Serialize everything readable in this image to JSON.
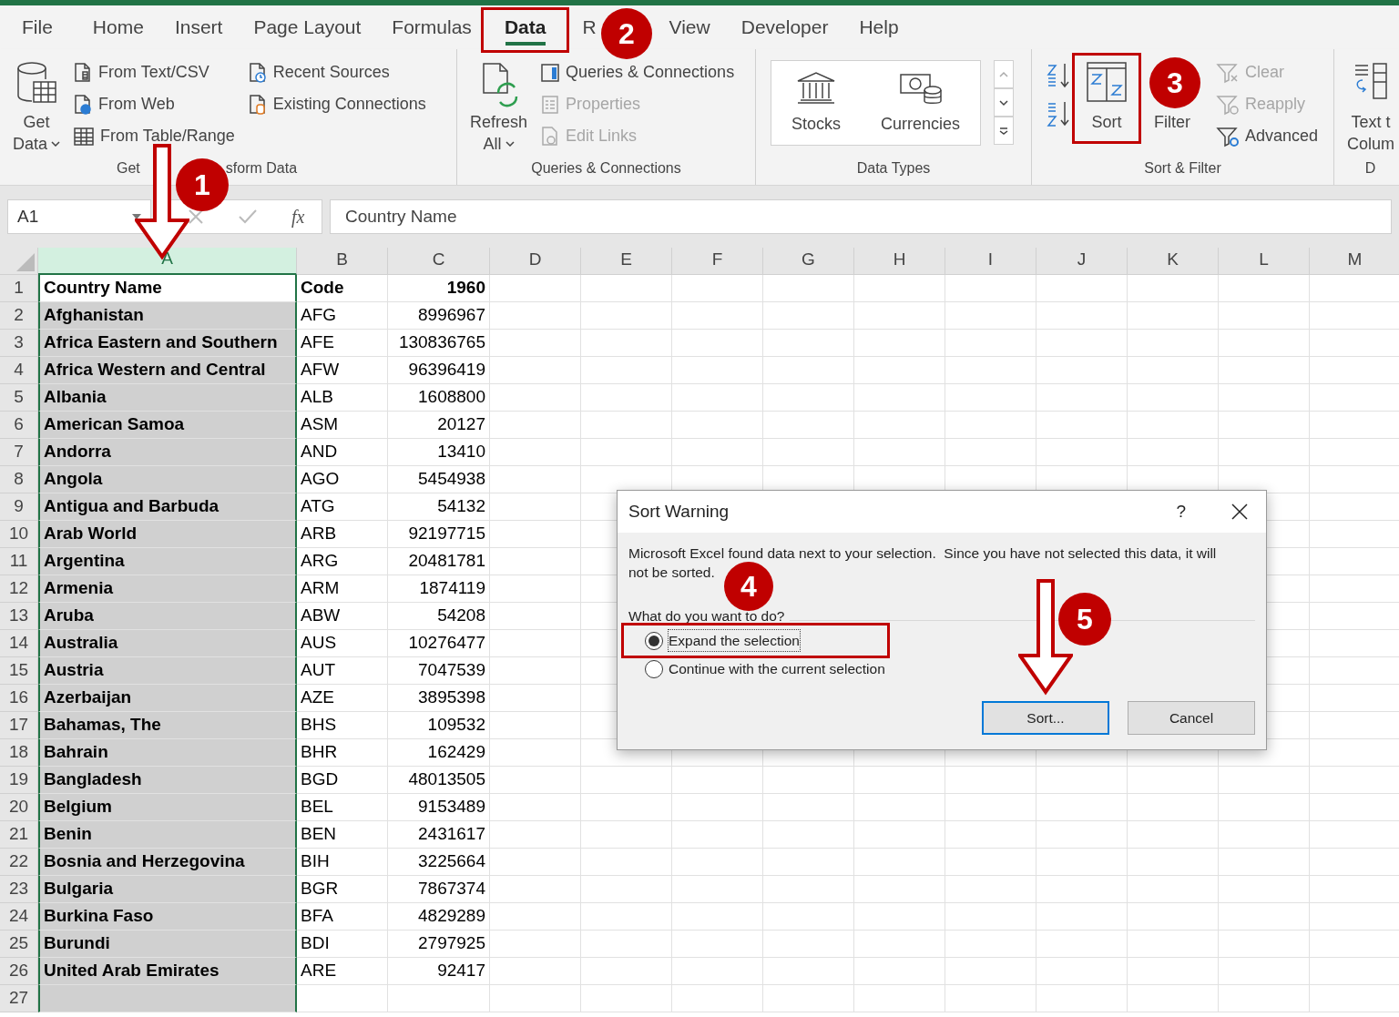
{
  "tabs": [
    {
      "label": "File",
      "selected": false
    },
    {
      "label": "Home",
      "selected": false
    },
    {
      "label": "Insert",
      "selected": false
    },
    {
      "label": "Page Layout",
      "selected": false
    },
    {
      "label": "Formulas",
      "selected": false
    },
    {
      "label": "Data",
      "selected": true,
      "highlighted": true
    },
    {
      "label": "R",
      "selected": false
    },
    {
      "label": "View",
      "selected": false
    },
    {
      "label": "Developer",
      "selected": false
    },
    {
      "label": "Help",
      "selected": false
    }
  ],
  "ribbon": {
    "groups": [
      {
        "title": "Get",
        "title_tail": "sform Data",
        "columns": [
          [
            {
              "kind": "large",
              "lines": [
                "Get",
                "Data"
              ],
              "dropdown": true,
              "disabled": false
            }
          ],
          [
            {
              "kind": "small",
              "label": "From Text/CSV",
              "disabled": false
            },
            {
              "kind": "small",
              "label": "From Web",
              "disabled": false
            },
            {
              "kind": "small",
              "label": "From Table/Range",
              "disabled": false
            }
          ],
          [
            {
              "kind": "small",
              "label": "Recent Sources",
              "disabled": false
            },
            {
              "kind": "small",
              "label": "Existing Connections",
              "disabled": false
            }
          ]
        ]
      },
      {
        "title": "Queries & Connections",
        "columns": [
          [
            {
              "kind": "large",
              "lines": [
                "Refresh",
                "All"
              ],
              "dropdown": true,
              "disabled": false
            }
          ],
          [
            {
              "kind": "small",
              "label": "Queries & Connections",
              "disabled": false
            },
            {
              "kind": "small",
              "label": "Properties",
              "disabled": true
            },
            {
              "kind": "small",
              "label": "Edit Links",
              "disabled": true
            }
          ]
        ]
      },
      {
        "title": "Data Types",
        "gallery": [
          {
            "label": "Stocks"
          },
          {
            "label": "Currencies"
          }
        ]
      },
      {
        "title": "Sort & Filter",
        "columns": [
          [
            {
              "kind": "icon",
              "disabled": false
            },
            {
              "kind": "icon",
              "disabled": false
            }
          ],
          [
            {
              "kind": "large",
              "lines": [
                "Sort"
              ],
              "dropdown": false,
              "disabled": false,
              "highlighted": true
            }
          ],
          [
            {
              "kind": "large",
              "lines": [
                "Filter"
              ],
              "dropdown": false,
              "disabled": false
            }
          ],
          [
            {
              "kind": "small",
              "label": "Clear",
              "disabled": true
            },
            {
              "kind": "small",
              "label": "Reapply",
              "disabled": true
            },
            {
              "kind": "small",
              "label": "Advanced",
              "disabled": false
            }
          ]
        ]
      },
      {
        "title": "D",
        "columns": [
          [
            {
              "kind": "large",
              "lines": [
                "Text t",
                "Colum"
              ],
              "dropdown": false,
              "disabled": false
            }
          ]
        ]
      }
    ]
  },
  "formula_bar": {
    "name_box": "A1",
    "function_label": "fx",
    "value": "Country Name"
  },
  "sheet": {
    "columns": [
      {
        "label": "A",
        "selected": true
      },
      {
        "label": "B",
        "selected": false
      },
      {
        "label": "C",
        "selected": false
      },
      {
        "label": "D",
        "selected": false
      },
      {
        "label": "E",
        "selected": false
      },
      {
        "label": "F",
        "selected": false
      },
      {
        "label": "G",
        "selected": false
      },
      {
        "label": "H",
        "selected": false
      },
      {
        "label": "I",
        "selected": false
      },
      {
        "label": "J",
        "selected": false
      },
      {
        "label": "K",
        "selected": false
      },
      {
        "label": "L",
        "selected": false
      },
      {
        "label": "M",
        "selected": false
      }
    ],
    "rows": [
      {
        "number": "1",
        "cells": [
          "Country Name",
          "Code",
          "1960"
        ]
      },
      {
        "number": "2",
        "cells": [
          "Afghanistan",
          "AFG",
          "8996967"
        ]
      },
      {
        "number": "3",
        "cells": [
          "Africa Eastern and Southern",
          "AFE",
          "130836765"
        ]
      },
      {
        "number": "4",
        "cells": [
          "Africa Western and Central",
          "AFW",
          "96396419"
        ]
      },
      {
        "number": "5",
        "cells": [
          "Albania",
          "ALB",
          "1608800"
        ]
      },
      {
        "number": "6",
        "cells": [
          "American Samoa",
          "ASM",
          "20127"
        ]
      },
      {
        "number": "7",
        "cells": [
          "Andorra",
          "AND",
          "13410"
        ]
      },
      {
        "number": "8",
        "cells": [
          "Angola",
          "AGO",
          "5454938"
        ]
      },
      {
        "number": "9",
        "cells": [
          "Antigua and Barbuda",
          "ATG",
          "54132"
        ]
      },
      {
        "number": "10",
        "cells": [
          "Arab World",
          "ARB",
          "92197715"
        ]
      },
      {
        "number": "11",
        "cells": [
          "Argentina",
          "ARG",
          "20481781"
        ]
      },
      {
        "number": "12",
        "cells": [
          "Armenia",
          "ARM",
          "1874119"
        ]
      },
      {
        "number": "13",
        "cells": [
          "Aruba",
          "ABW",
          "54208"
        ]
      },
      {
        "number": "14",
        "cells": [
          "Australia",
          "AUS",
          "10276477"
        ]
      },
      {
        "number": "15",
        "cells": [
          "Austria",
          "AUT",
          "7047539"
        ]
      },
      {
        "number": "16",
        "cells": [
          "Azerbaijan",
          "AZE",
          "3895398"
        ]
      },
      {
        "number": "17",
        "cells": [
          "Bahamas, The",
          "BHS",
          "109532"
        ]
      },
      {
        "number": "18",
        "cells": [
          "Bahrain",
          "BHR",
          "162429"
        ]
      },
      {
        "number": "19",
        "cells": [
          "Bangladesh",
          "BGD",
          "48013505"
        ]
      },
      {
        "number": "20",
        "cells": [
          "Belgium",
          "BEL",
          "9153489"
        ]
      },
      {
        "number": "21",
        "cells": [
          "Benin",
          "BEN",
          "2431617"
        ]
      },
      {
        "number": "22",
        "cells": [
          "Bosnia and Herzegovina",
          "BIH",
          "3225664"
        ]
      },
      {
        "number": "23",
        "cells": [
          "Bulgaria",
          "BGR",
          "7867374"
        ]
      },
      {
        "number": "24",
        "cells": [
          "Burkina Faso",
          "BFA",
          "4829289"
        ]
      },
      {
        "number": "25",
        "cells": [
          "Burundi",
          "BDI",
          "2797925"
        ]
      },
      {
        "number": "26",
        "cells": [
          "United Arab Emirates",
          "ARE",
          "92417"
        ]
      },
      {
        "number": "27",
        "cells": []
      }
    ]
  },
  "dialog": {
    "title": "Sort Warning",
    "help": "?",
    "message_lines": [
      "Microsoft Excel found data next to your selection.  Since you have not selected this data, it will",
      "not be sorted."
    ],
    "question": "What do you want to do?",
    "options": [
      {
        "label": "Expand the selection",
        "selected": true,
        "highlighted": true
      },
      {
        "label": "Continue with the current selection",
        "selected": false
      }
    ],
    "buttons": [
      {
        "label": "Sort...",
        "default": true
      },
      {
        "label": "Cancel",
        "default": false
      }
    ]
  },
  "annotations": [
    {
      "label": "1"
    },
    {
      "label": "2"
    },
    {
      "label": "3"
    },
    {
      "label": "4"
    },
    {
      "label": "5"
    }
  ]
}
